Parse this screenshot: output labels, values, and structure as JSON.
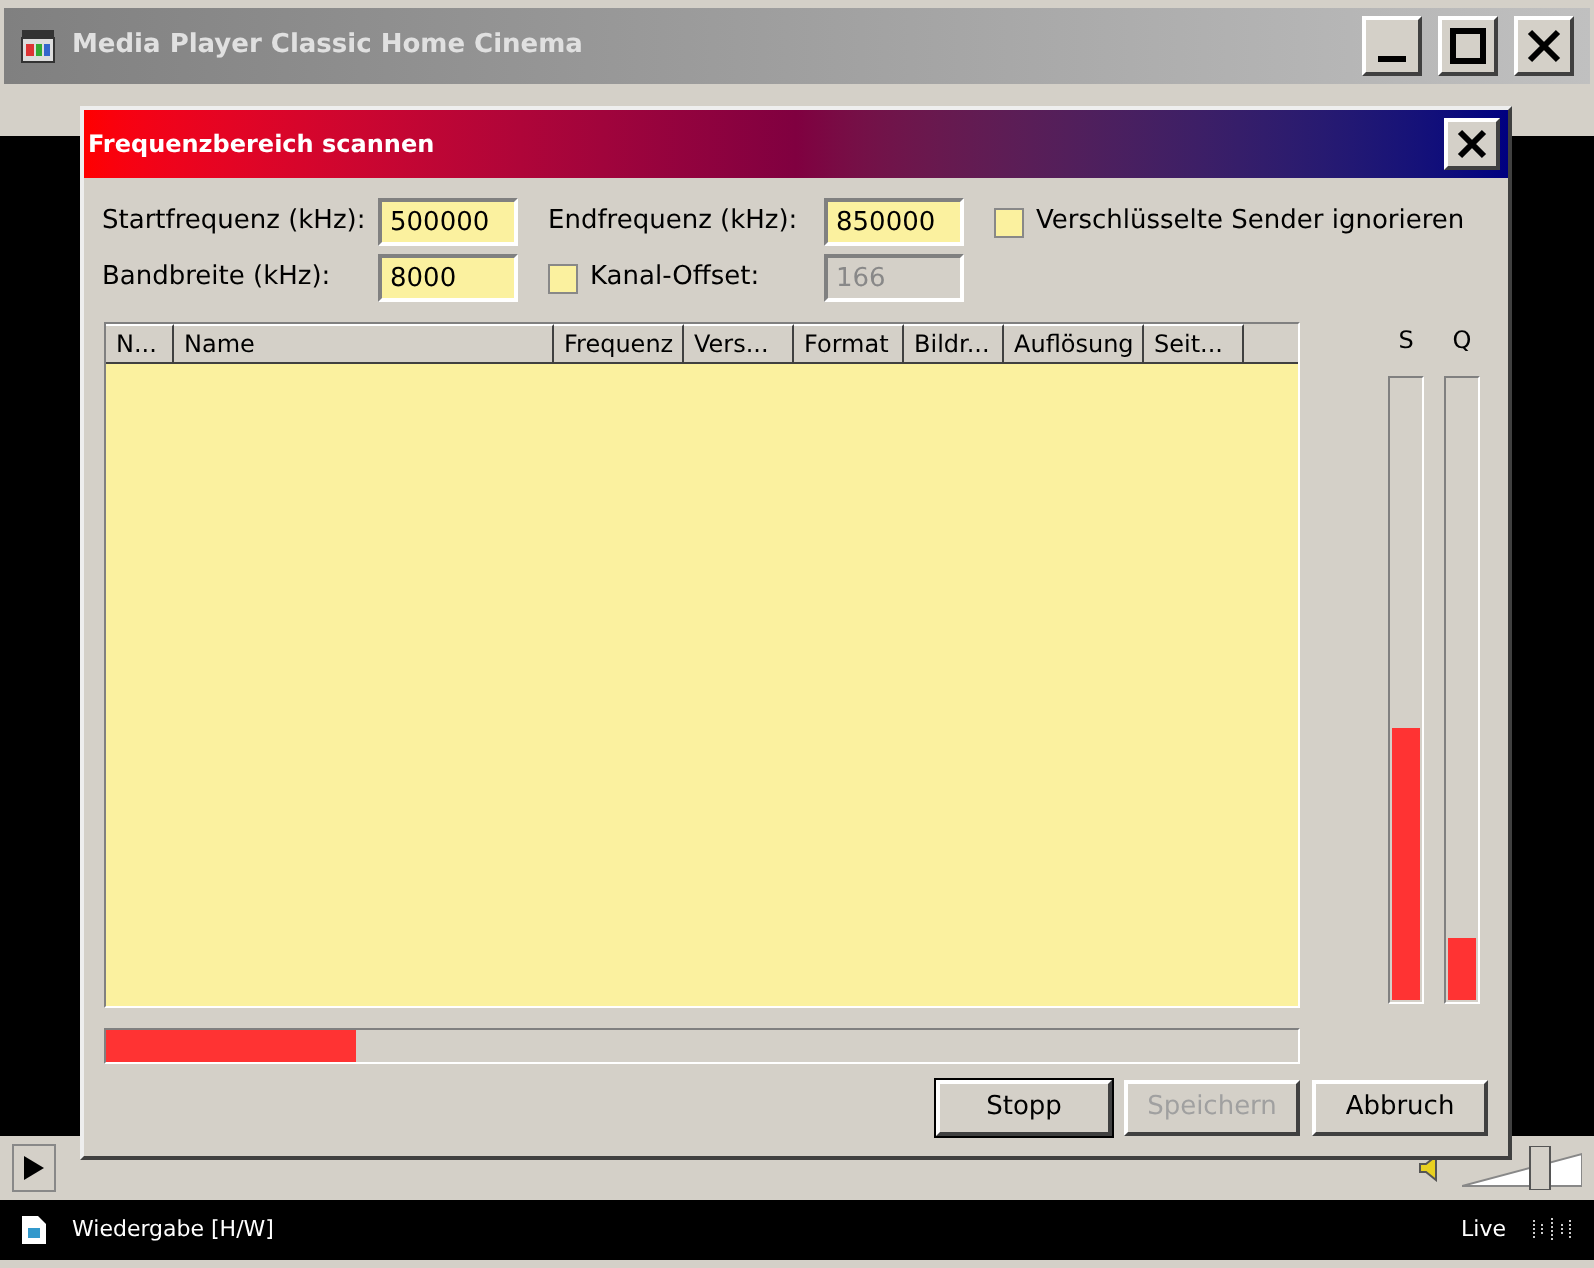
{
  "window": {
    "title": "Media Player Classic Home Cinema"
  },
  "volume": {
    "level": 0.68
  },
  "dialog": {
    "title": "Frequenzbereich scannen",
    "fields": [
      {
        "label": "Startfrequenz (kHz):",
        "value": "500000"
      },
      {
        "label": "Endfrequenz (kHz):",
        "value": "850000"
      },
      {
        "label": "Bandbreite (kHz):",
        "value": "8000"
      }
    ],
    "encrypted": {
      "label": "Verschlüsselte Sender ignorieren",
      "checked": false
    },
    "offset": {
      "label": "Kanal-Offset:",
      "checked": false,
      "value": "166",
      "disabled": true
    },
    "columns": [
      "N...",
      "Name",
      "Frequenz",
      "Vers...",
      "Format",
      "Bildr...",
      "Auflösung",
      "Seit..."
    ],
    "meters": [
      {
        "label": "S",
        "level": 0.44
      },
      {
        "label": "Q",
        "level": 0.1
      }
    ],
    "progress": {
      "level": 0.21
    },
    "buttons": [
      {
        "label": "Stopp",
        "disabled": false,
        "default": true
      },
      {
        "label": "Speichern",
        "disabled": true,
        "default": false
      },
      {
        "label": "Abbruch",
        "disabled": false,
        "default": false
      }
    ]
  },
  "status_bar": {
    "text": "Wiedergabe [H/W]",
    "mode": "Live"
  }
}
